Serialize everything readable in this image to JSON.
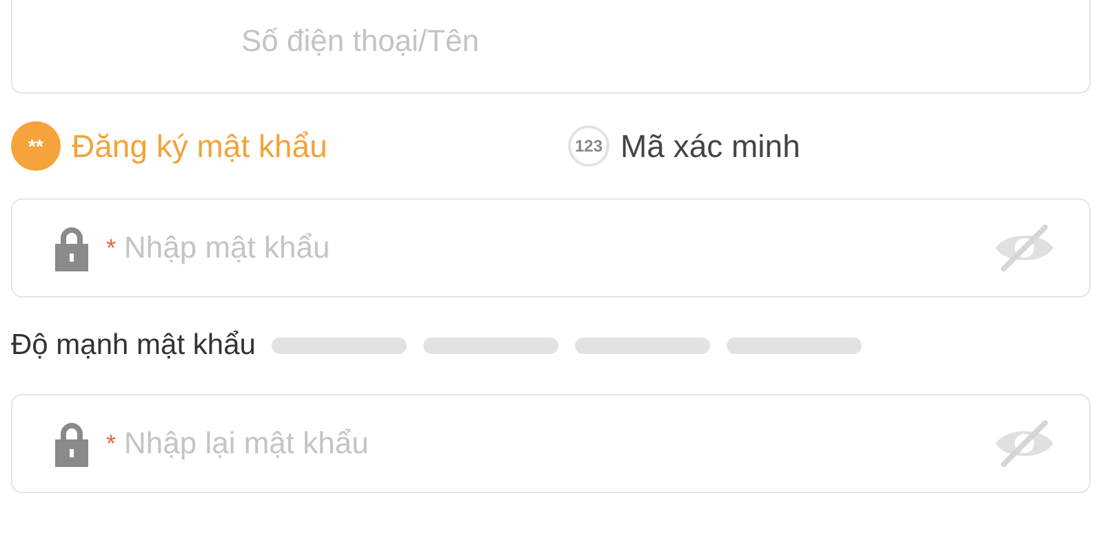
{
  "account_field": {
    "placeholder": "Số điện thoại/Tên"
  },
  "tabs": [
    {
      "icon_text": "**",
      "label": "Đăng ký mật khẩu",
      "selected": true
    },
    {
      "icon_text": "123",
      "label": "Mã xác minh",
      "selected": false
    }
  ],
  "password_field": {
    "required_mark": "*",
    "placeholder": "Nhập mật khẩu",
    "masked": true
  },
  "strength": {
    "label": "Độ mạnh mật khẩu",
    "segments": [
      {
        "on": false
      },
      {
        "on": false
      },
      {
        "on": false
      },
      {
        "on": false
      }
    ]
  },
  "confirm_field": {
    "required_mark": "*",
    "placeholder": "Nhập lại mật khẩu",
    "masked": true
  }
}
